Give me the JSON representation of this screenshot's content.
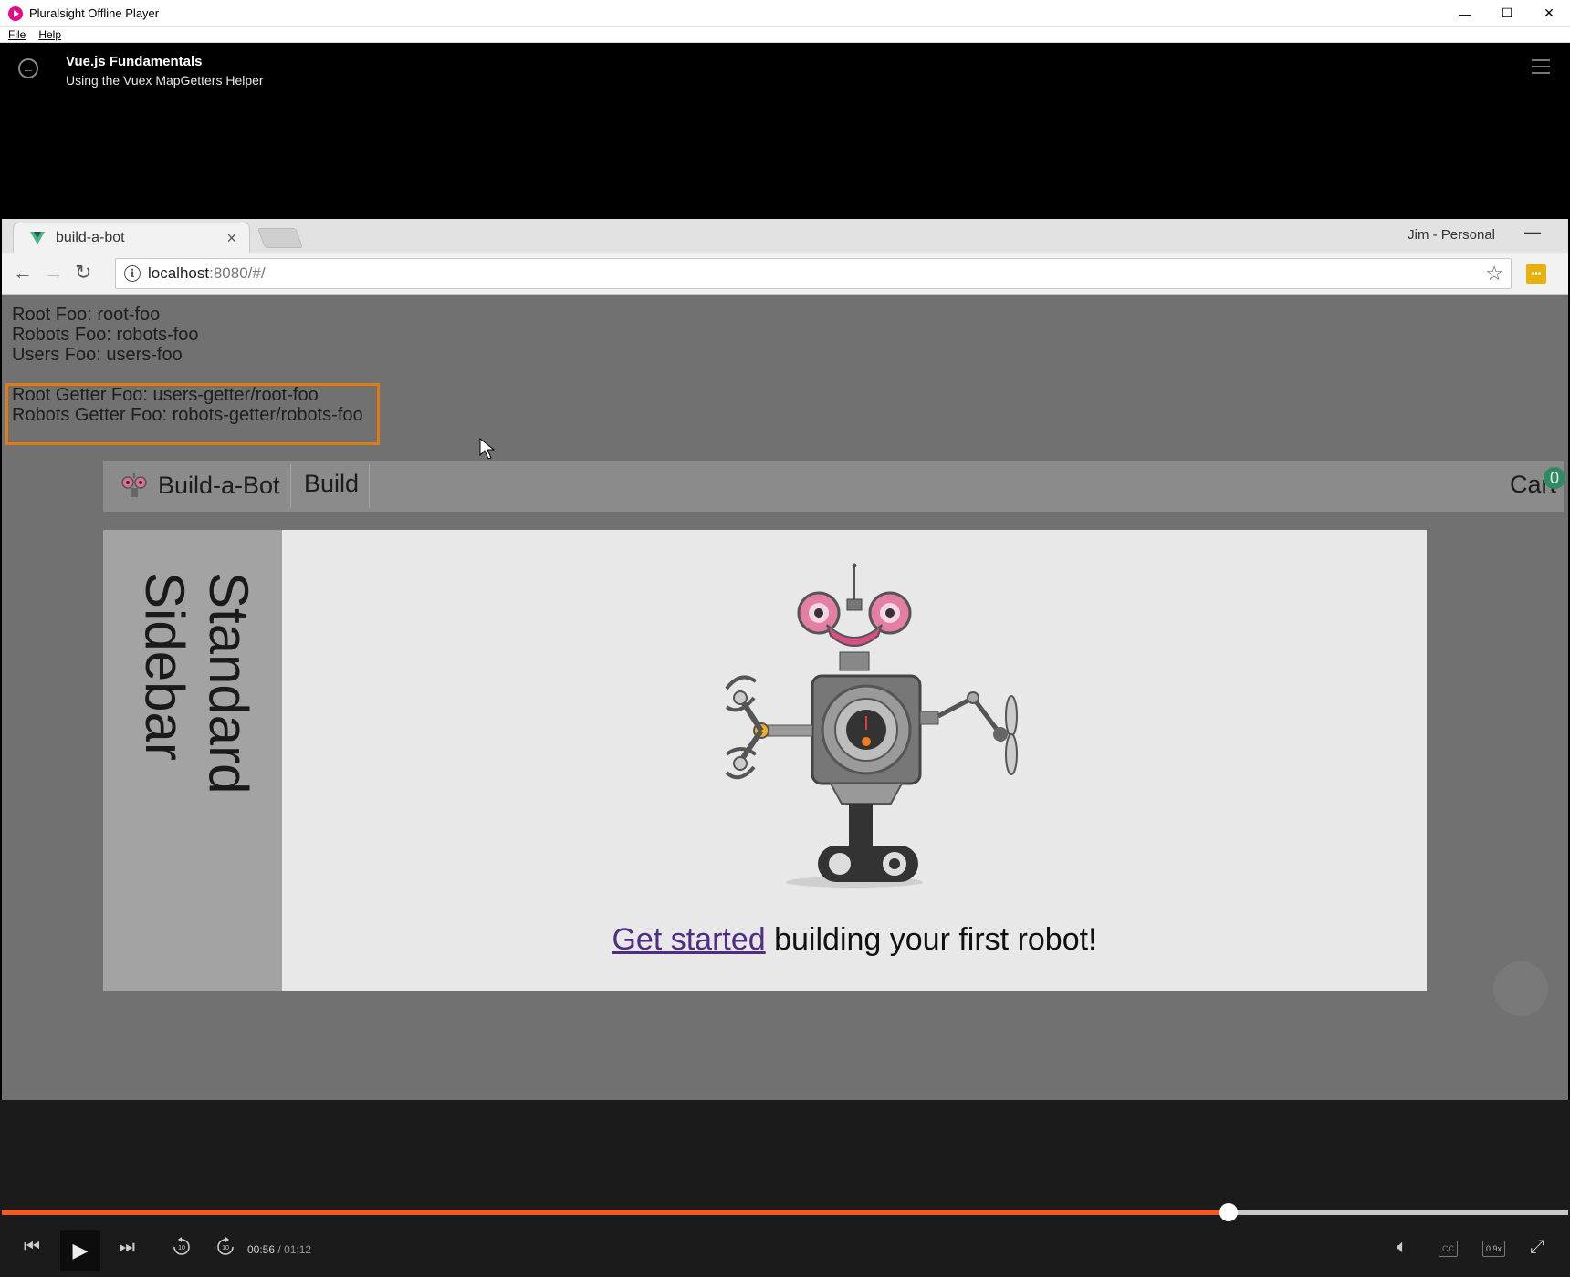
{
  "window": {
    "title": "Pluralsight Offline Player",
    "controls": {
      "minimize": "—",
      "maximize": "☐",
      "close": "✕"
    }
  },
  "menu": [
    "File",
    "Help"
  ],
  "header": {
    "course_title": "Vue.js Fundamentals",
    "clip_title": "Using the Vuex MapGetters Helper"
  },
  "browser": {
    "tab_title": "build-a-bot",
    "tab_close": "×",
    "profile": "Jim - Personal",
    "url_host": "localhost",
    "url_rest": ":8080/#/"
  },
  "page": {
    "foo_lines": [
      "Root Foo: root-foo",
      "Robots Foo: robots-foo",
      "Users Foo: users-foo"
    ],
    "getter_lines": [
      "Root Getter Foo: users-getter/root-foo",
      "Robots Getter Foo: robots-getter/robots-foo"
    ],
    "nav": {
      "brand": "Build-a-Bot",
      "build": "Build",
      "cart": "Cart",
      "cart_count": "0"
    },
    "sidebar_text": "Standard Sidebar",
    "cta_link": "Get started",
    "cta_rest": " building your first robot!"
  },
  "player": {
    "current_time": "00:56",
    "separator": "/",
    "total_time": "01:12",
    "progress": 0.783,
    "speed": "0.9x",
    "cc": "CC",
    "rewind_label": "10",
    "forward_label": "10"
  },
  "colors": {
    "progress": "#f15b2a",
    "highlight": "#e07b12",
    "vue_green": "#41b883",
    "link": "#4f2d84"
  }
}
